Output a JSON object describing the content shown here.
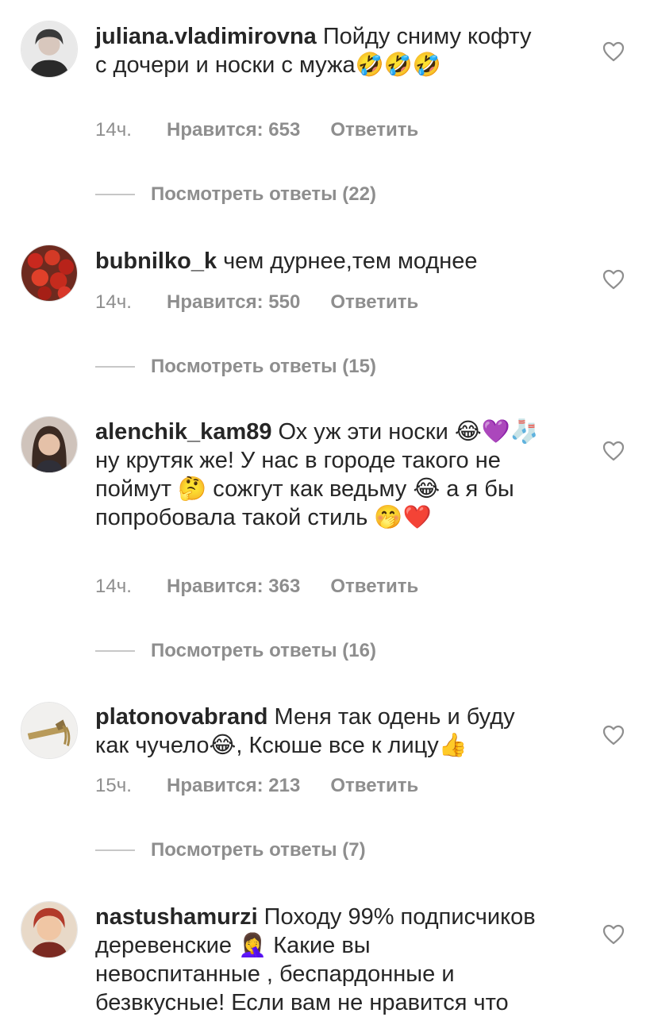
{
  "colors": {
    "text": "#262626",
    "secondary": "#8e8e8e",
    "divider": "#c7c7c7",
    "background": "#ffffff"
  },
  "comments": [
    {
      "username": "juliana.vladimirovna",
      "text": "Пойду сниму кофту с дочери и носки с мужа🤣🤣🤣",
      "time": "14ч.",
      "likes": "Нравится: 653",
      "reply": "Ответить",
      "view_replies": "Посмотреть ответы (22)"
    },
    {
      "username": "bubnilko_k",
      "text": "чем дурнее,тем моднее",
      "time": "14ч.",
      "likes": "Нравится: 550",
      "reply": "Ответить",
      "view_replies": "Посмотреть ответы (15)"
    },
    {
      "username": "alenchik_kam89",
      "text": "Ох уж эти носки 😂💜🧦 ну крутяк же! У нас в городе такого не поймут 🤔 сожгут как ведьму 😂 а я бы попробовала такой стиль 🤭❤️",
      "time": "14ч.",
      "likes": "Нравится: 363",
      "reply": "Ответить",
      "view_replies": "Посмотреть ответы (16)"
    },
    {
      "username": "platonovabrand",
      "text": "Меня так одень и буду как чучело😂, Ксюше все к лицу👍",
      "time": "15ч.",
      "likes": "Нравится: 213",
      "reply": "Ответить",
      "view_replies": "Посмотреть ответы (7)"
    },
    {
      "username": "nastushamurzi",
      "text": "Походу 99% подписчиков деревенские 🤦‍♀️ Какие вы невоспитанные , беспардонные и безвкусные! Если вам не нравится что"
    }
  ]
}
